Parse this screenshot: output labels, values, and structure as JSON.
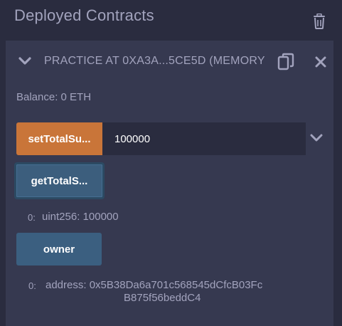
{
  "header": {
    "title": "Deployed Contracts"
  },
  "instance": {
    "label": "PRACTICE AT 0XA3A...5CE5D (MEMORY",
    "balance": "Balance: 0 ETH"
  },
  "functions": {
    "setTotalSupply": {
      "label": "setTotalSu...",
      "input_value": "100000"
    },
    "getTotalSupply": {
      "label": "getTotalS...",
      "result_index": "0:",
      "result_value": "uint256: 100000"
    },
    "owner": {
      "label": "owner",
      "result_index": "0:",
      "result_line1": "address: 0x5B38Da6a701c568545dCfcB03Fc",
      "result_line2": "B875f56beddC4"
    }
  },
  "colors": {
    "background": "#2a2c3f",
    "panel": "#363950",
    "text": "#a2a3bd",
    "transact_button": "#c97539",
    "call_button": "#3b5f80"
  },
  "icons": [
    "trash-icon",
    "chevron-down-icon",
    "copy-icon",
    "close-icon"
  ]
}
